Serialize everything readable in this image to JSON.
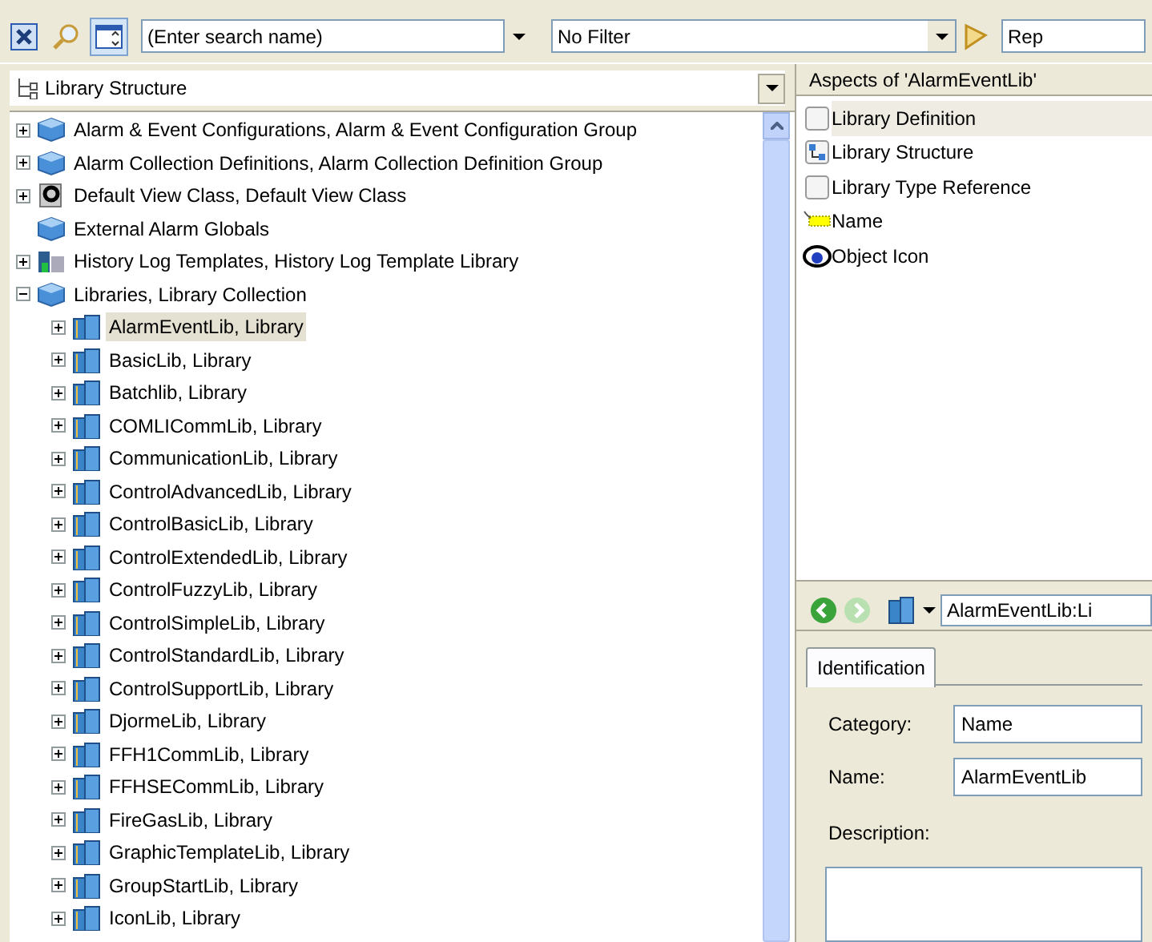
{
  "toolbar": {
    "search": {
      "placeholder": "(Enter search name)"
    },
    "filter": {
      "value": "No Filter"
    },
    "cut_field": {
      "value": "Rep"
    }
  },
  "structure_selector": {
    "value": "Library Structure"
  },
  "tree": [
    {
      "label": "Alarm & Event Configurations, Alarm & Event Configuration Group",
      "kind": "group",
      "expandable": true,
      "expanded": false,
      "selected": false
    },
    {
      "label": "Alarm Collection Definitions, Alarm Collection Definition Group",
      "kind": "group",
      "expandable": true,
      "expanded": false,
      "selected": false
    },
    {
      "label": "Default View Class, Default View Class",
      "kind": "view",
      "expandable": true,
      "expanded": false,
      "selected": false
    },
    {
      "label": "External Alarm Globals",
      "kind": "group",
      "expandable": false,
      "selected": false
    },
    {
      "label": "History Log Templates, History Log Template Library",
      "kind": "history",
      "expandable": true,
      "expanded": false,
      "selected": false
    },
    {
      "label": "Libraries, Library Collection",
      "kind": "group",
      "expandable": true,
      "expanded": true,
      "selected": false,
      "children": [
        {
          "label": "AlarmEventLib, Library",
          "kind": "library",
          "expandable": true,
          "expanded": false,
          "selected": true
        },
        {
          "label": "BasicLib, Library",
          "kind": "library",
          "expandable": true,
          "expanded": false,
          "selected": false
        },
        {
          "label": "Batchlib, Library",
          "kind": "library",
          "expandable": true,
          "expanded": false,
          "selected": false
        },
        {
          "label": "COMLICommLib, Library",
          "kind": "library",
          "expandable": true,
          "expanded": false,
          "selected": false
        },
        {
          "label": "CommunicationLib, Library",
          "kind": "library",
          "expandable": true,
          "expanded": false,
          "selected": false
        },
        {
          "label": "ControlAdvancedLib, Library",
          "kind": "library",
          "expandable": true,
          "expanded": false,
          "selected": false
        },
        {
          "label": "ControlBasicLib, Library",
          "kind": "library",
          "expandable": true,
          "expanded": false,
          "selected": false
        },
        {
          "label": "ControlExtendedLib, Library",
          "kind": "library",
          "expandable": true,
          "expanded": false,
          "selected": false
        },
        {
          "label": "ControlFuzzyLib, Library",
          "kind": "library",
          "expandable": true,
          "expanded": false,
          "selected": false
        },
        {
          "label": "ControlSimpleLib, Library",
          "kind": "library",
          "expandable": true,
          "expanded": false,
          "selected": false
        },
        {
          "label": "ControlStandardLib, Library",
          "kind": "library",
          "expandable": true,
          "expanded": false,
          "selected": false
        },
        {
          "label": "ControlSupportLib, Library",
          "kind": "library",
          "expandable": true,
          "expanded": false,
          "selected": false
        },
        {
          "label": "DjormeLib, Library",
          "kind": "library",
          "expandable": true,
          "expanded": false,
          "selected": false
        },
        {
          "label": "FFH1CommLib, Library",
          "kind": "library",
          "expandable": true,
          "expanded": false,
          "selected": false
        },
        {
          "label": "FFHSECommLib, Library",
          "kind": "library",
          "expandable": true,
          "expanded": false,
          "selected": false
        },
        {
          "label": "FireGasLib, Library",
          "kind": "library",
          "expandable": true,
          "expanded": false,
          "selected": false
        },
        {
          "label": "GraphicTemplateLib, Library",
          "kind": "library",
          "expandable": true,
          "expanded": false,
          "selected": false
        },
        {
          "label": "GroupStartLib, Library",
          "kind": "library",
          "expandable": true,
          "expanded": false,
          "selected": false
        },
        {
          "label": "IconLib, Library",
          "kind": "library",
          "expandable": true,
          "expanded": false,
          "selected": false
        }
      ]
    }
  ],
  "aspects": {
    "title": "Aspects of 'AlarmEventLib'",
    "items": [
      {
        "label": "Library Definition",
        "kind": "blank",
        "selected": true
      },
      {
        "label": "Library Structure",
        "kind": "structure",
        "selected": false
      },
      {
        "label": "Library Type Reference",
        "kind": "blank",
        "selected": false
      },
      {
        "label": "Name",
        "kind": "name",
        "selected": false
      },
      {
        "label": "Object Icon",
        "kind": "eye",
        "selected": false
      }
    ]
  },
  "detail": {
    "path": {
      "value": "AlarmEventLib:Li"
    },
    "tabs": [
      {
        "label": "Identification",
        "selected": true
      }
    ],
    "fields": [
      {
        "label": "Category:",
        "value": "Name"
      },
      {
        "label": "Name:",
        "value": "AlarmEventLib"
      }
    ],
    "description": {
      "label": "Description:"
    }
  }
}
